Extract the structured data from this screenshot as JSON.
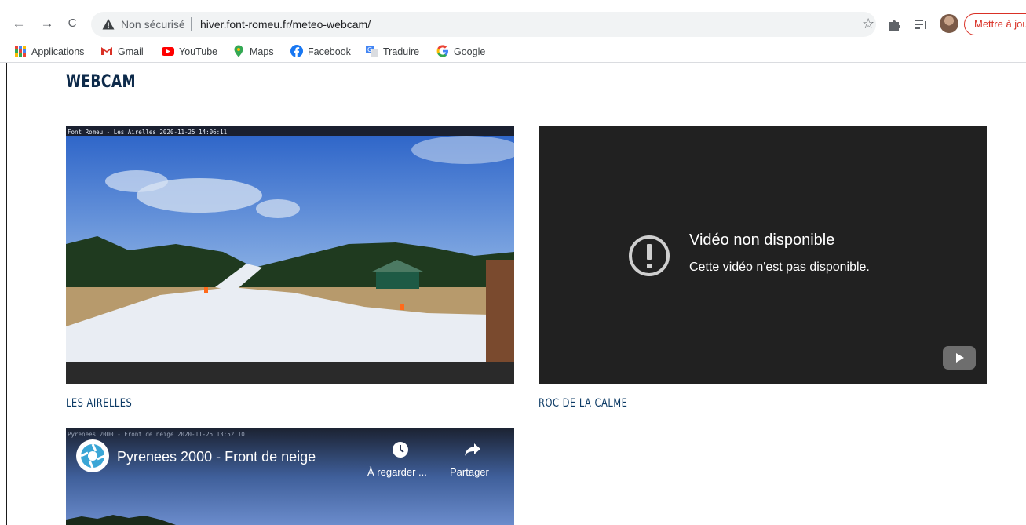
{
  "browser": {
    "back_label": "←",
    "forward_label": "→",
    "reload_label": "C",
    "security_text": "Non sécurisé",
    "url": "hiver.font-romeu.fr/meteo-webcam/",
    "update_label": "Mettre à jour"
  },
  "bookmarks": [
    {
      "label": "Applications",
      "icon": "apps-grid-icon"
    },
    {
      "label": "Gmail",
      "icon": "gmail-icon"
    },
    {
      "label": "YouTube",
      "icon": "youtube-icon"
    },
    {
      "label": "Maps",
      "icon": "maps-pin-icon"
    },
    {
      "label": "Facebook",
      "icon": "facebook-icon"
    },
    {
      "label": "Traduire",
      "icon": "translate-icon"
    },
    {
      "label": "Google",
      "icon": "google-icon"
    }
  ],
  "page": {
    "title": "WEBCAM",
    "webcams": [
      {
        "caption": "LES AIRELLES",
        "overlay": "Font Romeu - Les Airelles 2020-11-25 14:06:11"
      },
      {
        "caption": "ROC DE LA CALME",
        "error_title": "Vidéo non disponible",
        "error_message": "Cette vidéo n'est pas disponible."
      },
      {
        "overlay": "Pyrenees 2000 - Front de neige 2020-11-25 13:52:10",
        "video_title": "Pyrenees 2000 - Front de neige",
        "watch_later_label": "À regarder ...",
        "share_label": "Partager"
      }
    ]
  },
  "colors": {
    "heading": "#0d2a4a",
    "caption": "#0d3b66",
    "update_button": "#d93025",
    "player_bg": "#212121"
  }
}
